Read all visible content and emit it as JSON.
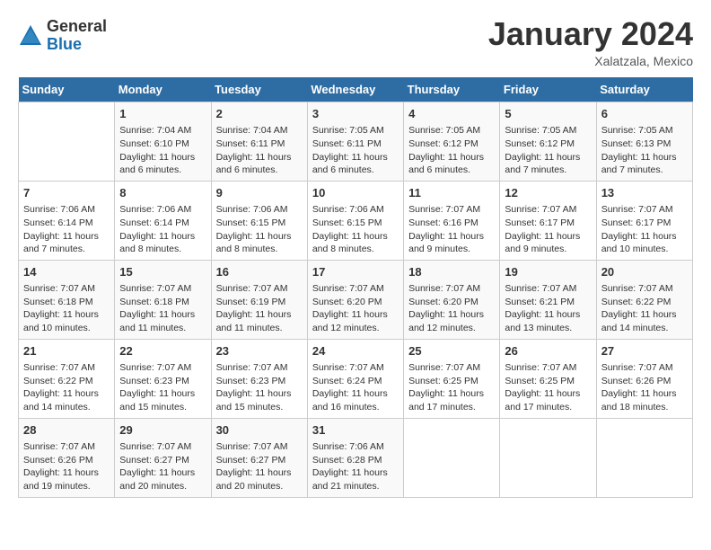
{
  "logo": {
    "general": "General",
    "blue": "Blue"
  },
  "title": "January 2024",
  "location": "Xalatzala, Mexico",
  "days_header": [
    "Sunday",
    "Monday",
    "Tuesday",
    "Wednesday",
    "Thursday",
    "Friday",
    "Saturday"
  ],
  "weeks": [
    [
      {
        "day": "",
        "info": ""
      },
      {
        "day": "1",
        "info": "Sunrise: 7:04 AM\nSunset: 6:10 PM\nDaylight: 11 hours and 6 minutes."
      },
      {
        "day": "2",
        "info": "Sunrise: 7:04 AM\nSunset: 6:11 PM\nDaylight: 11 hours and 6 minutes."
      },
      {
        "day": "3",
        "info": "Sunrise: 7:05 AM\nSunset: 6:11 PM\nDaylight: 11 hours and 6 minutes."
      },
      {
        "day": "4",
        "info": "Sunrise: 7:05 AM\nSunset: 6:12 PM\nDaylight: 11 hours and 6 minutes."
      },
      {
        "day": "5",
        "info": "Sunrise: 7:05 AM\nSunset: 6:12 PM\nDaylight: 11 hours and 7 minutes."
      },
      {
        "day": "6",
        "info": "Sunrise: 7:05 AM\nSunset: 6:13 PM\nDaylight: 11 hours and 7 minutes."
      }
    ],
    [
      {
        "day": "7",
        "info": "Sunrise: 7:06 AM\nSunset: 6:14 PM\nDaylight: 11 hours and 7 minutes."
      },
      {
        "day": "8",
        "info": "Sunrise: 7:06 AM\nSunset: 6:14 PM\nDaylight: 11 hours and 8 minutes."
      },
      {
        "day": "9",
        "info": "Sunrise: 7:06 AM\nSunset: 6:15 PM\nDaylight: 11 hours and 8 minutes."
      },
      {
        "day": "10",
        "info": "Sunrise: 7:06 AM\nSunset: 6:15 PM\nDaylight: 11 hours and 8 minutes."
      },
      {
        "day": "11",
        "info": "Sunrise: 7:07 AM\nSunset: 6:16 PM\nDaylight: 11 hours and 9 minutes."
      },
      {
        "day": "12",
        "info": "Sunrise: 7:07 AM\nSunset: 6:17 PM\nDaylight: 11 hours and 9 minutes."
      },
      {
        "day": "13",
        "info": "Sunrise: 7:07 AM\nSunset: 6:17 PM\nDaylight: 11 hours and 10 minutes."
      }
    ],
    [
      {
        "day": "14",
        "info": "Sunrise: 7:07 AM\nSunset: 6:18 PM\nDaylight: 11 hours and 10 minutes."
      },
      {
        "day": "15",
        "info": "Sunrise: 7:07 AM\nSunset: 6:18 PM\nDaylight: 11 hours and 11 minutes."
      },
      {
        "day": "16",
        "info": "Sunrise: 7:07 AM\nSunset: 6:19 PM\nDaylight: 11 hours and 11 minutes."
      },
      {
        "day": "17",
        "info": "Sunrise: 7:07 AM\nSunset: 6:20 PM\nDaylight: 11 hours and 12 minutes."
      },
      {
        "day": "18",
        "info": "Sunrise: 7:07 AM\nSunset: 6:20 PM\nDaylight: 11 hours and 12 minutes."
      },
      {
        "day": "19",
        "info": "Sunrise: 7:07 AM\nSunset: 6:21 PM\nDaylight: 11 hours and 13 minutes."
      },
      {
        "day": "20",
        "info": "Sunrise: 7:07 AM\nSunset: 6:22 PM\nDaylight: 11 hours and 14 minutes."
      }
    ],
    [
      {
        "day": "21",
        "info": "Sunrise: 7:07 AM\nSunset: 6:22 PM\nDaylight: 11 hours and 14 minutes."
      },
      {
        "day": "22",
        "info": "Sunrise: 7:07 AM\nSunset: 6:23 PM\nDaylight: 11 hours and 15 minutes."
      },
      {
        "day": "23",
        "info": "Sunrise: 7:07 AM\nSunset: 6:23 PM\nDaylight: 11 hours and 15 minutes."
      },
      {
        "day": "24",
        "info": "Sunrise: 7:07 AM\nSunset: 6:24 PM\nDaylight: 11 hours and 16 minutes."
      },
      {
        "day": "25",
        "info": "Sunrise: 7:07 AM\nSunset: 6:25 PM\nDaylight: 11 hours and 17 minutes."
      },
      {
        "day": "26",
        "info": "Sunrise: 7:07 AM\nSunset: 6:25 PM\nDaylight: 11 hours and 17 minutes."
      },
      {
        "day": "27",
        "info": "Sunrise: 7:07 AM\nSunset: 6:26 PM\nDaylight: 11 hours and 18 minutes."
      }
    ],
    [
      {
        "day": "28",
        "info": "Sunrise: 7:07 AM\nSunset: 6:26 PM\nDaylight: 11 hours and 19 minutes."
      },
      {
        "day": "29",
        "info": "Sunrise: 7:07 AM\nSunset: 6:27 PM\nDaylight: 11 hours and 20 minutes."
      },
      {
        "day": "30",
        "info": "Sunrise: 7:07 AM\nSunset: 6:27 PM\nDaylight: 11 hours and 20 minutes."
      },
      {
        "day": "31",
        "info": "Sunrise: 7:06 AM\nSunset: 6:28 PM\nDaylight: 11 hours and 21 minutes."
      },
      {
        "day": "",
        "info": ""
      },
      {
        "day": "",
        "info": ""
      },
      {
        "day": "",
        "info": ""
      }
    ]
  ]
}
